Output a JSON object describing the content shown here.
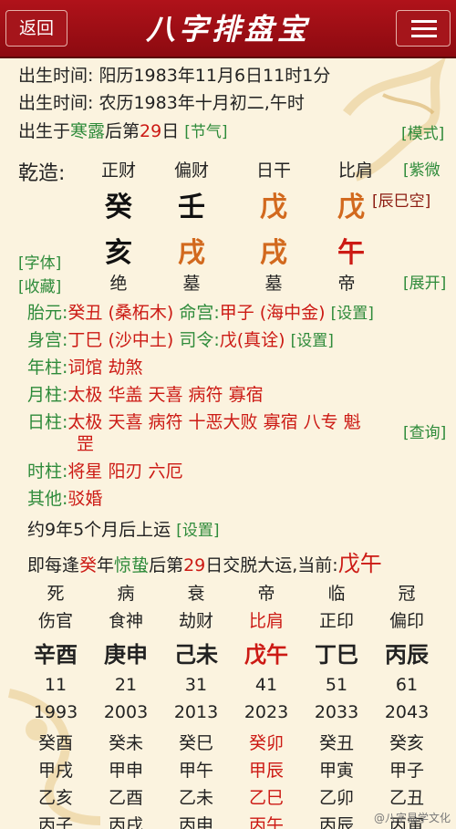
{
  "header": {
    "back_label": "返回",
    "title": "八字排盘宝",
    "menu_icon": "hamburger-menu-icon"
  },
  "info": {
    "solar": "出生时间: 阳历1983年11月6日11时1分",
    "lunar": "出生时间: 农历1983年十月初二,午时",
    "term_prefix": "出生于",
    "term_name": "寒露",
    "term_mid": "后第",
    "term_days": "29",
    "term_suffix": "日",
    "term_link": "[节气]",
    "mode_link": "[模式]"
  },
  "chart": {
    "gender_label": "乾造:",
    "ten_gods": [
      "正财",
      "偏财",
      "日干",
      "比肩"
    ],
    "stems": [
      {
        "char": "癸",
        "color": "#111111"
      },
      {
        "char": "壬",
        "color": "#111111"
      },
      {
        "char": "戊",
        "color": "#d2691e"
      },
      {
        "char": "戊",
        "color": "#d2691e"
      }
    ],
    "branches": [
      {
        "char": "亥",
        "color": "#111111"
      },
      {
        "char": "戌",
        "color": "#d2691e"
      },
      {
        "char": "戌",
        "color": "#d2691e"
      },
      {
        "char": "午",
        "color": "#cc1a14"
      }
    ],
    "phases": [
      "绝",
      "墓",
      "墓",
      "帝"
    ],
    "empty_label": "[辰巳空]",
    "ziwei_link": "[紫微",
    "font_link": "[字体]",
    "fav_link": "[收藏]",
    "expand_link": "[展开]"
  },
  "extra": {
    "taiyuan_label": "胎元:",
    "taiyuan_value": "癸丑 (桑柘木)",
    "minggong_label": "命宫:",
    "minggong_value": "甲子 (海中金)",
    "set1": "[设置]",
    "shengong_label": "身宫:",
    "shengong_value": "丁巳 (沙中土)",
    "siling_label": "司令:",
    "siling_value": "戊(真诠)",
    "set2": "[设置]",
    "year_label": "年柱:",
    "year_value": "词馆 劫煞",
    "month_label": "月柱:",
    "month_value": "太极 华盖 天喜 病符 寡宿",
    "day_label": "日柱:",
    "day_value": "太极 天喜 病符 十恶大败 寡宿 八专 魁",
    "day_value2": "罡",
    "query_link": "[查询]",
    "hour_label": "时柱:",
    "hour_value": "将星 阳刃 六厄",
    "other_label": "其他:",
    "other_value": "驳婚"
  },
  "luck": {
    "start_text": "约9年5个月后上运",
    "set3": "[设置]",
    "rule_a": "即每逢",
    "rule_stem": "癸",
    "rule_b": "年",
    "rule_term": "惊蛰",
    "rule_c": "后第",
    "rule_days": "29",
    "rule_d": "日交脱大运,当前:",
    "current": "戊午",
    "phases": [
      "死",
      "病",
      "衰",
      "帝",
      "临",
      "冠"
    ],
    "gods": [
      "伤官",
      "食神",
      "劫财",
      "比肩",
      "正印",
      "偏印"
    ],
    "pillars": [
      "辛酉",
      "庚申",
      "己未",
      "戊午",
      "丁巳",
      "丙辰"
    ],
    "ages": [
      "11",
      "21",
      "31",
      "41",
      "51",
      "61"
    ],
    "years": [
      "1993",
      "2003",
      "2013",
      "2023",
      "2033",
      "2043"
    ],
    "row1": [
      "癸酉",
      "癸未",
      "癸巳",
      "癸卯",
      "癸丑",
      "癸亥"
    ],
    "row2": [
      "甲戌",
      "甲申",
      "甲午",
      "甲辰",
      "甲寅",
      "甲子"
    ],
    "row3": [
      "乙亥",
      "乙酉",
      "乙未",
      "乙巳",
      "乙卯",
      "乙丑"
    ],
    "row4": [
      "丙子",
      "丙戌",
      "丙申",
      "丙午",
      "丙辰",
      "丙寅"
    ],
    "current_color": "#cc1a14"
  },
  "watermark": "@八字易学文化"
}
